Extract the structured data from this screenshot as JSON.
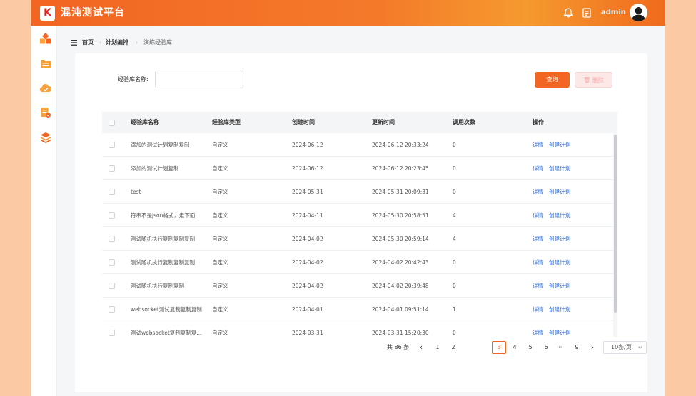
{
  "app": {
    "logo_letter": "K",
    "title": "混沌测试平台",
    "username": "admin",
    "accent_color": "#f26522"
  },
  "topbar_icons": [
    "bell-icon",
    "document-icon"
  ],
  "sidebar_icons": [
    "cubes-icon",
    "folder-icon",
    "cloud-check-icon",
    "report-icon",
    "layers-icon"
  ],
  "breadcrumb": {
    "menu_icon": "menu-icon",
    "items": [
      "首页",
      "计划编排",
      "演练经验库"
    ]
  },
  "filter": {
    "label": "经验库名称:",
    "value": "",
    "placeholder": "",
    "query_label": "查询",
    "delete_label": "删除"
  },
  "table": {
    "columns": [
      "经验库名称",
      "经验库类型",
      "创建时间",
      "更新时间",
      "调用次数",
      "操作"
    ],
    "rows": [
      {
        "name": "添加的测试计划复制复制",
        "type": "自定义",
        "created": "2024-06-12",
        "updated": "2024-06-12 20:33:24",
        "calls": "0"
      },
      {
        "name": "添加的测试计划复制",
        "type": "自定义",
        "created": "2024-06-12",
        "updated": "2024-06-12 20:23:45",
        "calls": "0"
      },
      {
        "name": "test",
        "type": "自定义",
        "created": "2024-05-31",
        "updated": "2024-05-31 20:09:31",
        "calls": "0"
      },
      {
        "name": "符串不是json格式，走下面...",
        "type": "自定义",
        "created": "2024-04-11",
        "updated": "2024-05-30 20:58:51",
        "calls": "4"
      },
      {
        "name": "测试随机执行复制复制复制",
        "type": "自定义",
        "created": "2024-04-02",
        "updated": "2024-05-30 20:59:14",
        "calls": "4"
      },
      {
        "name": "测试随机执行复制复制复制",
        "type": "自定义",
        "created": "2024-04-02",
        "updated": "2024-04-02 20:42:43",
        "calls": "0"
      },
      {
        "name": "测试随机执行复制复制",
        "type": "自定义",
        "created": "2024-04-02",
        "updated": "2024-04-02 20:39:48",
        "calls": "0"
      },
      {
        "name": "websocket测试复制复制复制",
        "type": "自定义",
        "created": "2024-04-01",
        "updated": "2024-04-01 09:51:14",
        "calls": "1"
      },
      {
        "name": "测试websocket复制复制复...",
        "type": "自定义",
        "created": "2024-03-31",
        "updated": "2024-03-31 15:20:30",
        "calls": "0"
      }
    ],
    "action_detail": "详情",
    "action_create": "创建计划"
  },
  "pagination": {
    "total": "共 86 条",
    "prev": "‹",
    "next": "›",
    "pages": [
      "1",
      "2",
      "3",
      "4",
      "5",
      "6",
      "···",
      "9"
    ],
    "current": "3",
    "page_size": "10条/页"
  }
}
